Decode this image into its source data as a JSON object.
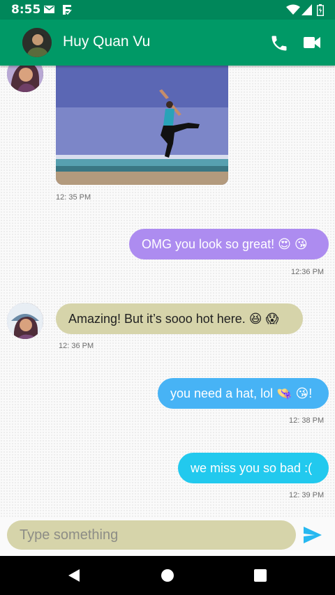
{
  "status_bar": {
    "time": "8:55",
    "icons": [
      "mail-icon",
      "download-check-icon",
      "wifi-icon",
      "signal-icon",
      "battery-icon"
    ]
  },
  "header": {
    "contact_name": "Huy Quan Vu",
    "actions": [
      "phone-icon",
      "video-camera-icon"
    ]
  },
  "messages": [
    {
      "direction": "incoming",
      "type": "image",
      "time": "12: 35 PM"
    },
    {
      "direction": "outgoing",
      "text": "OMG you look so great! 😍 😘",
      "time": "12:36 PM",
      "color": "#ad8cf0"
    },
    {
      "direction": "incoming",
      "text": "Amazing! But it’s sooo hot here. 😆 😱",
      "time": "12: 36 PM",
      "color": "#d6d4aa"
    },
    {
      "direction": "outgoing",
      "text": "you need a hat, lol 👒 😘!",
      "time": "12: 38 PM",
      "color": "#47b3f5"
    },
    {
      "direction": "outgoing",
      "text": "we miss you so bad :(",
      "time": "12: 39 PM",
      "color": "#22c9ee"
    }
  ],
  "composer": {
    "placeholder": "Type something",
    "send_icon": "send-icon"
  },
  "nav": [
    "back-icon",
    "home-icon",
    "recents-icon"
  ],
  "colors": {
    "app_bar": "#009966",
    "status_bar": "#00875a",
    "send_icon": "#27b8f0"
  }
}
